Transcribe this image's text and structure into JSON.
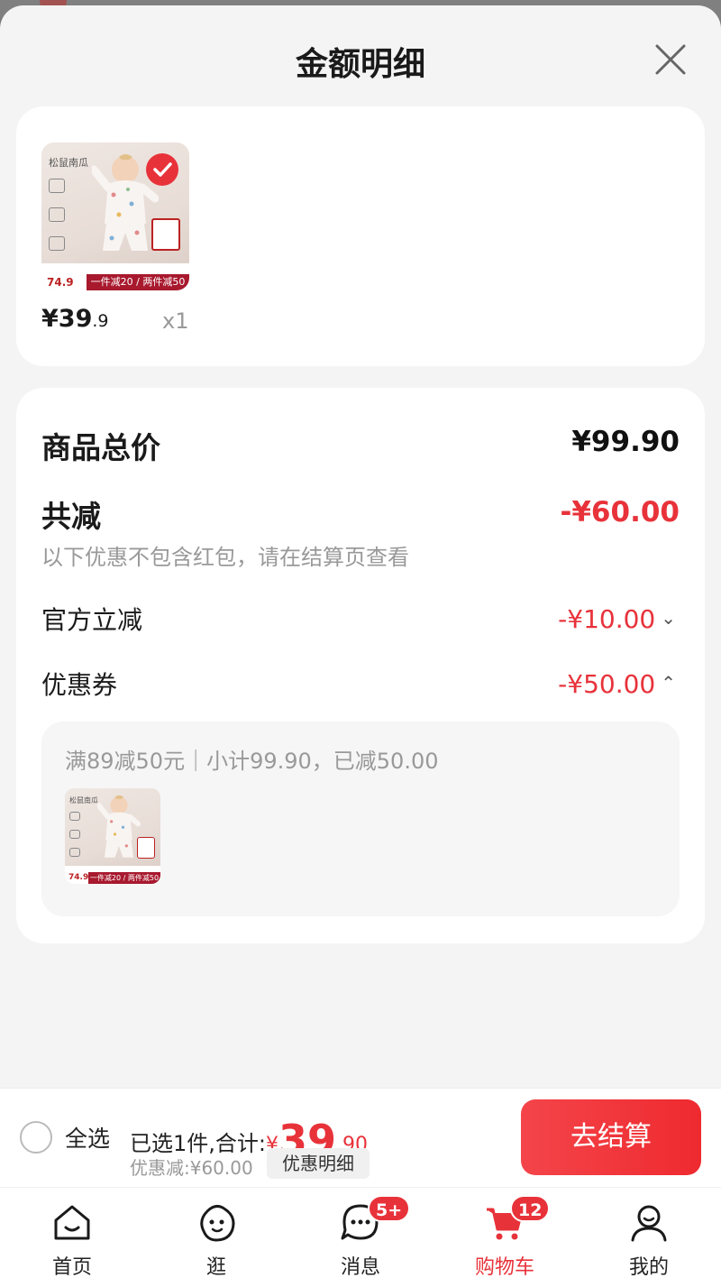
{
  "sheet": {
    "title": "金额明细"
  },
  "product": {
    "thumbnail": {
      "brand": "松鼠南瓜",
      "promo": "一件减20 / 两件减50",
      "promo_price": "74.9",
      "selected": true
    },
    "price_int": "¥39",
    "price_dec": ".9",
    "quantity": "x1"
  },
  "summary": {
    "total_label": "商品总价",
    "total_value": "¥99.90",
    "reduce_label": "共减",
    "reduce_value": "-¥60.00",
    "note": "以下优惠不包含红包，请在结算页查看",
    "official_label": "官方立减",
    "official_value": "-¥10.00",
    "coupon_label": "优惠券",
    "coupon_value": "-¥50.00",
    "coupon_detail": "满89减50元｜小计99.90，已减50.00"
  },
  "bottom_bar": {
    "select_all": "全选",
    "selected_text": "已选1件,合计:",
    "yen": "¥",
    "amount_int": "39",
    "amount_dec": ".90",
    "discount_text": "优惠减:¥60.00",
    "detail_button": "优惠明细",
    "checkout_button": "去结算"
  },
  "tabbar": {
    "tabs": [
      {
        "label": "首页",
        "icon": "home-icon"
      },
      {
        "label": "逛",
        "icon": "browse-face-icon"
      },
      {
        "label": "消息",
        "icon": "message-icon",
        "badge": "5+"
      },
      {
        "label": "购物车",
        "icon": "cart-icon",
        "badge": "12",
        "active": true
      },
      {
        "label": "我的",
        "icon": "profile-icon"
      }
    ]
  },
  "colors": {
    "accent": "#e8323a",
    "background": "#f4f4f4",
    "card": "#ffffff",
    "muted_text": "#999999"
  }
}
